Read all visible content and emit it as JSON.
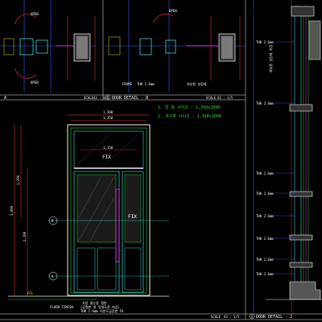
{
  "colors": {
    "background": "#000000",
    "frame": "#f2f2f2",
    "dimension": "#ff3b3b",
    "leader": "#3b5bff",
    "glass": "#3fd6d6",
    "frame_green": "#3bd13b",
    "text": "#ffffff",
    "yellow": "#e8e800",
    "magenta": "#ff3bff",
    "insulation": "#9a9a9a"
  },
  "panel_a": {
    "open_top": "OPEN",
    "open_bottom": "OPEN",
    "title_letter": "A",
    "scale_label": "SCALE",
    "scale_value": "A3 : 1/5"
  },
  "panel_b": {
    "open_top": "OPEN",
    "number": "2",
    "title": "DOOR DETAIL - B",
    "scale_label": "SCALE",
    "scale_value": "A3 : 1/5",
    "frame_label": "FRAME",
    "thk_note": "THK 2.6mm",
    "ext_note": "외부용 실링재"
  },
  "elevation": {
    "fix_top": "FIX",
    "fix_side": "FIX",
    "opening_size": "1. 문 틀 사이즈 : 1,350x2890",
    "frame_size": "2. 개구부 사이즈 : 1,390x3000",
    "dim_top_1": "1,390",
    "dim_top_2": "1,350",
    "dim_width_inner": "1,150",
    "dim_height_total": "3,000",
    "dim_height_1": "1,290",
    "dim_height_2": "2,100",
    "fl_label": "FFL",
    "floor_label": "FLOOR FINISH",
    "marker_b": "B",
    "marker_a": "A",
    "bottom_note_1": "치장 줄눈용 철판",
    "bottom_note_2": "(강철판 위 방청도장 마감)",
    "bottom_note_3": "THK 1.6mm 아연도금강판 FA"
  },
  "panel_2": {
    "number": "4",
    "title": "DOOR DETAIL - 2",
    "scale_label": "SCALE",
    "scale_value": "A3 : 1/5",
    "thk_labels": [
      "THK 2.6mm",
      "THK 2.6mm",
      "THK 2.6mm",
      "THK 2.6mm",
      "THK 2.6mm",
      "THK 2.6mm",
      "THK 2.6mm",
      "THK 2.6mm"
    ],
    "right_note": "외부용 실링재 마감"
  }
}
